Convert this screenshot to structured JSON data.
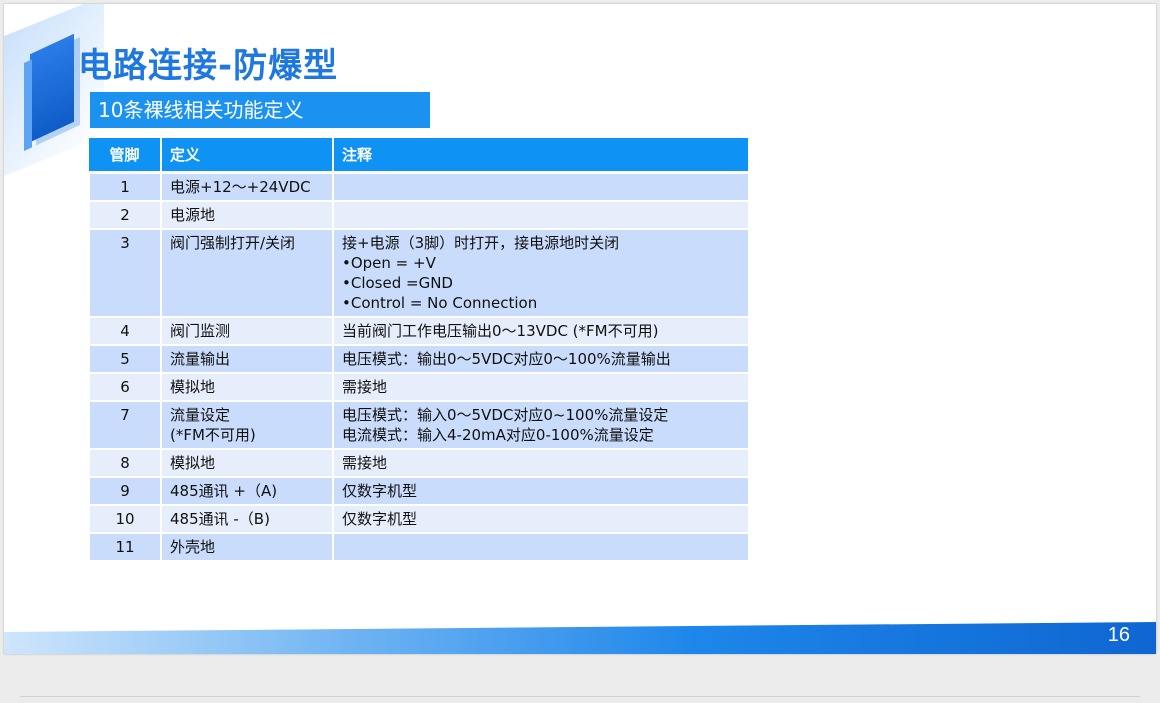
{
  "slide": {
    "title": "电路连接-防爆型",
    "subtitle": "10条裸线相关功能定义",
    "page_number": "16"
  },
  "table": {
    "headers": [
      "管脚",
      "定义",
      "注释"
    ],
    "rows": [
      {
        "pin": "1",
        "def": [
          "电源+12～+24VDC"
        ],
        "note": []
      },
      {
        "pin": "2",
        "def": [
          "电源地"
        ],
        "note": []
      },
      {
        "pin": "3",
        "def": [
          "阀门强制打开/关闭"
        ],
        "note": [
          "接+电源（3脚）时打开，接电源地时关闭",
          "•Open = +V",
          "•Closed =GND",
          "•Control = No Connection"
        ]
      },
      {
        "pin": "4",
        "def": [
          "阀门监测"
        ],
        "note": [
          "当前阀门工作电压输出0～13VDC (*FM不可用)"
        ]
      },
      {
        "pin": "5",
        "def": [
          "流量输出"
        ],
        "note": [
          "电压模式：输出0～5VDC对应0～100%流量输出"
        ]
      },
      {
        "pin": "6",
        "def": [
          "模拟地"
        ],
        "note": [
          "需接地"
        ]
      },
      {
        "pin": "7",
        "def": [
          "流量设定",
          "(*FM不可用)"
        ],
        "note": [
          "电压模式：输入0～5VDC对应0~100%流量设定",
          "电流模式：输入4-20mA对应0-100%流量设定"
        ]
      },
      {
        "pin": "8",
        "def": [
          "模拟地"
        ],
        "note": [
          "需接地"
        ]
      },
      {
        "pin": "9",
        "def": [
          "485通讯 +（A)"
        ],
        "note": [
          "仅数字机型"
        ]
      },
      {
        "pin": "10",
        "def": [
          "485通讯 -（B)"
        ],
        "note": [
          "仅数字机型"
        ]
      },
      {
        "pin": "11",
        "def": [
          "外壳地"
        ],
        "note": []
      }
    ]
  },
  "colors": {
    "title": "#1e78e0",
    "header_bg": "#0e93f4",
    "row_odd": "#c9dcfb",
    "row_even": "#e6eefc"
  }
}
